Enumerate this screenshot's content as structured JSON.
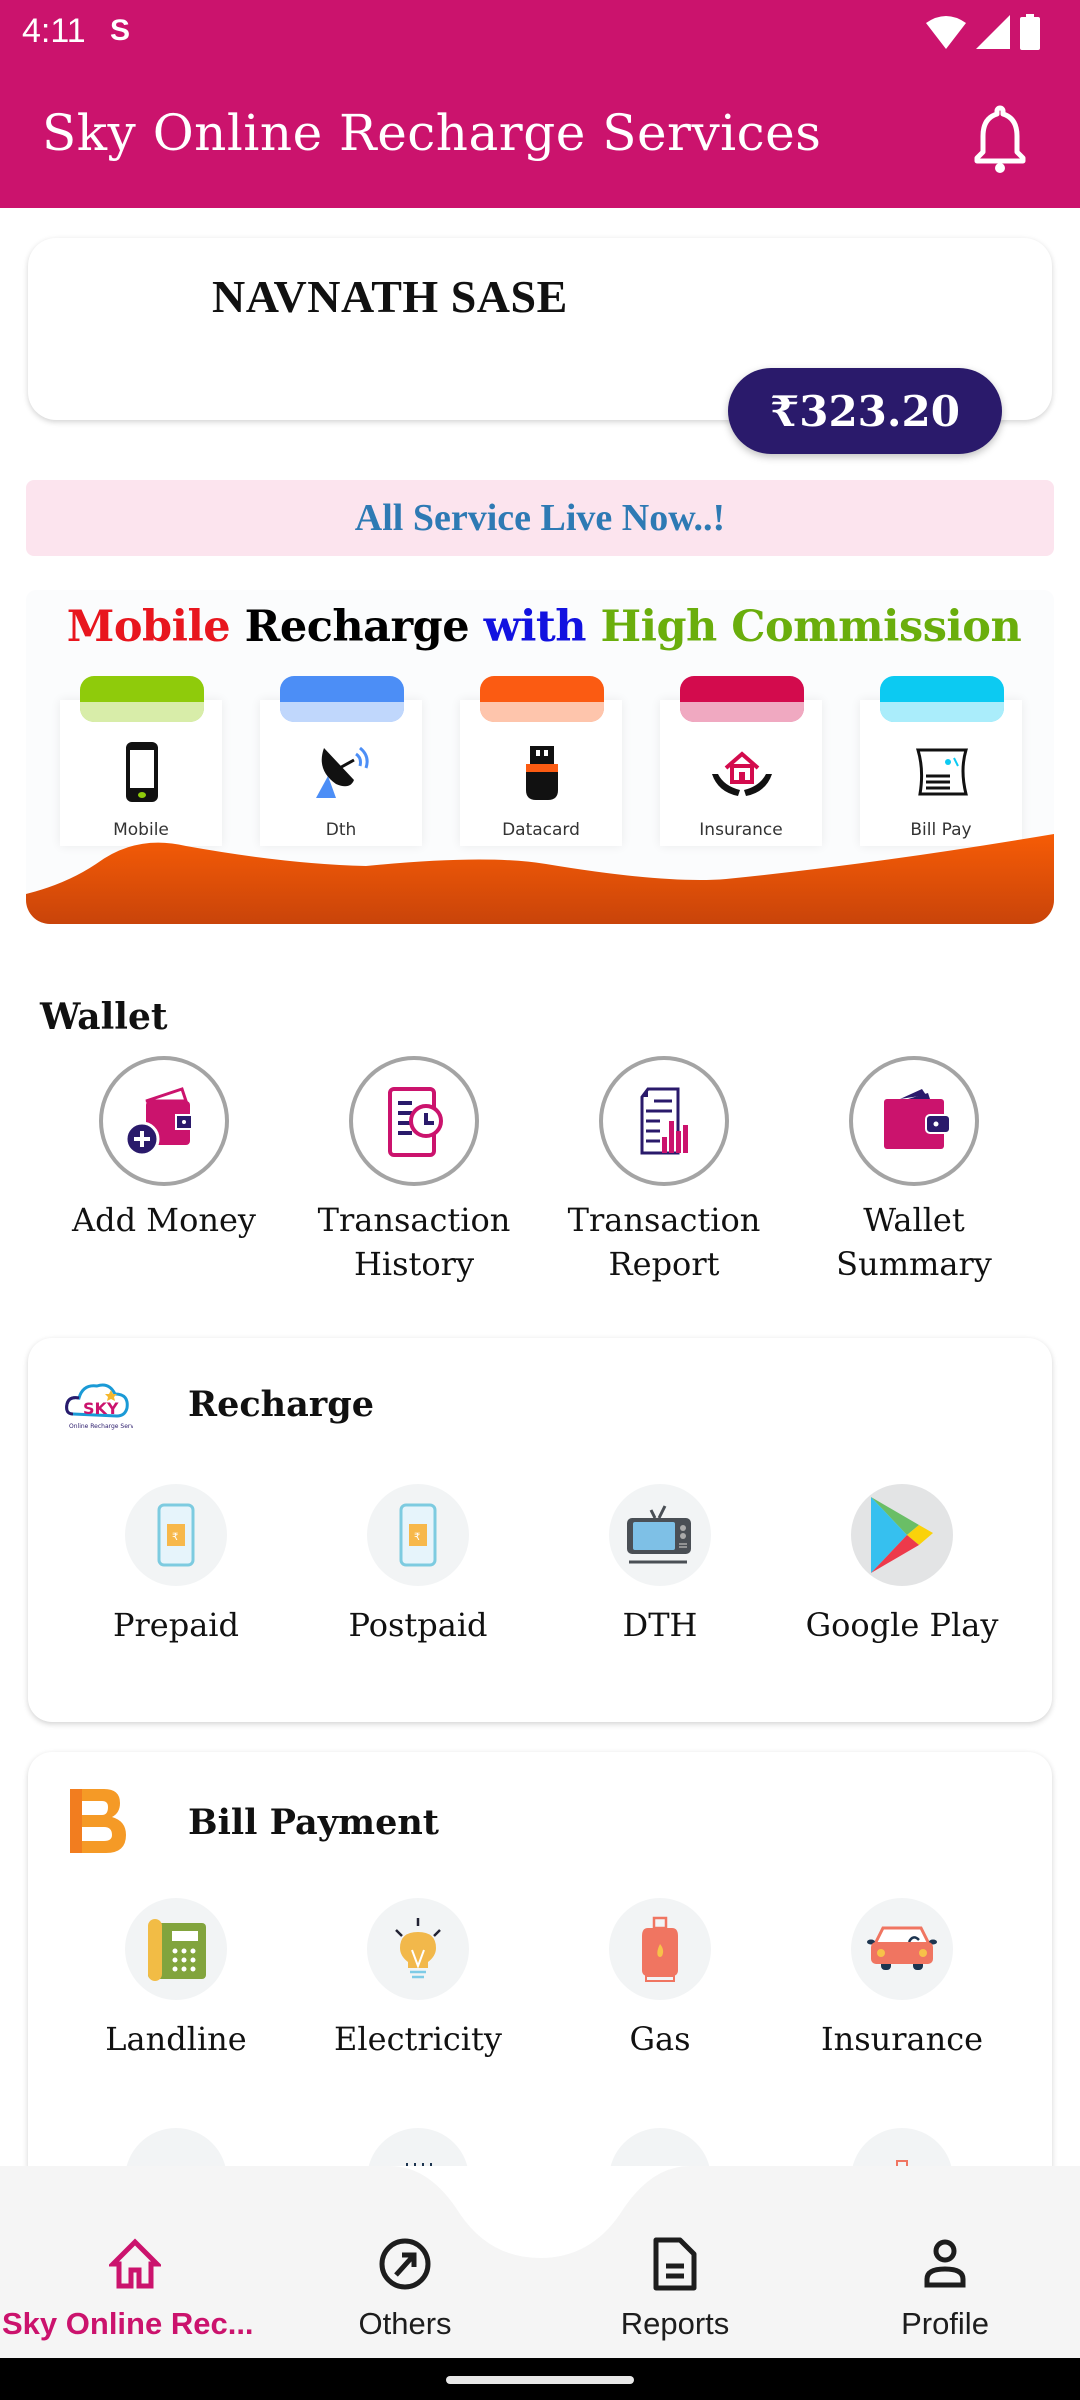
{
  "status_bar": {
    "time": "4:11"
  },
  "app_bar": {
    "title": "Sky Online Recharge Services",
    "notification_icon": "bell-icon"
  },
  "user_card": {
    "name": "NAVNATH SASE",
    "balance": "₹323.20"
  },
  "notice": {
    "text": "All Service Live Now..!"
  },
  "banner": {
    "headline_parts": [
      {
        "text": "Mobile ",
        "color": "#e8161e"
      },
      {
        "text": "Recharge ",
        "color": "#000000"
      },
      {
        "text": "with ",
        "color": "#1212e0"
      },
      {
        "text": "High Commission",
        "color": "#6aae0c"
      }
    ],
    "tiles": [
      {
        "label": "Mobile",
        "icon": "mobile-phone-icon",
        "color": "#8fcb0b"
      },
      {
        "label": "Dth",
        "icon": "satellite-dish-icon",
        "color": "#4c8ef6"
      },
      {
        "label": "Datacard",
        "icon": "usb-dongle-icon",
        "color": "#fb5b12"
      },
      {
        "label": "Insurance",
        "icon": "house-hands-icon",
        "color": "#d30b4d"
      },
      {
        "label": "Bill Pay",
        "icon": "bill-receipt-icon",
        "color": "#0ccaf2"
      }
    ]
  },
  "wallet": {
    "title": "Wallet",
    "items": [
      {
        "label": "Add Money",
        "icon": "add-money-wallet-icon"
      },
      {
        "label": "Transaction History",
        "icon": "transaction-history-icon"
      },
      {
        "label": "Transaction Report",
        "icon": "transaction-report-icon"
      },
      {
        "label": "Wallet Summary",
        "icon": "wallet-icon"
      }
    ]
  },
  "recharge": {
    "title": "Recharge",
    "items": [
      {
        "label": "Prepaid",
        "icon": "prepaid-phone-icon"
      },
      {
        "label": "Postpaid",
        "icon": "postpaid-phone-icon"
      },
      {
        "label": "DTH",
        "icon": "tv-icon"
      },
      {
        "label": "Google Play",
        "icon": "google-play-icon"
      }
    ]
  },
  "bill_payment": {
    "title": "Bill Payment",
    "items": [
      {
        "label": "Landline",
        "icon": "landline-phone-icon"
      },
      {
        "label": "Electricity",
        "icon": "light-bulb-icon"
      },
      {
        "label": "Gas",
        "icon": "gas-cylinder-icon"
      },
      {
        "label": "Insurance",
        "icon": "car-icon"
      }
    ],
    "partial_row_icons": [
      "broadband-icon",
      "calendar-bill-icon",
      "water-tap-icon",
      "gas-cylinder-icon"
    ]
  },
  "bottom_nav": {
    "items": [
      {
        "label": "Sky Online Rec...",
        "icon": "home-icon",
        "active": true
      },
      {
        "label": "Others",
        "icon": "explore-arrow-icon",
        "active": false
      },
      {
        "label": "Reports",
        "icon": "document-icon",
        "active": false
      },
      {
        "label": "Profile",
        "icon": "person-icon",
        "active": false
      }
    ]
  },
  "colors": {
    "primary": "#cb136d",
    "balance_pill": "#2a1a6b",
    "notice_bg": "#fce4ee",
    "notice_text": "#2e7ab4"
  }
}
